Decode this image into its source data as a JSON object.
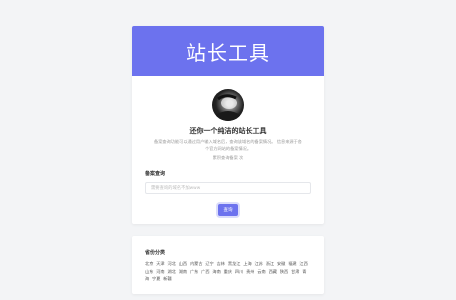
{
  "banner": {
    "title": "站长工具"
  },
  "intro": {
    "subtitle": "还你一个纯洁的站长工具",
    "description": "备案查询功能可以通过用户输入域名后，查询该域名的备案情况。 信息来源于各个官方网站的备案情况。",
    "count_text": "累积查询备案 次"
  },
  "query": {
    "label": "备案查询",
    "placeholder": "需要查询的域名不加www",
    "value": "",
    "button_label": "查询"
  },
  "provinces": {
    "title": "省份分类",
    "items": [
      "北京",
      "天津",
      "河北",
      "山西",
      "内蒙古",
      "辽宁",
      "吉林",
      "黑龙江",
      "上海",
      "江苏",
      "浙江",
      "安徽",
      "福建",
      "江西",
      "山东",
      "河南",
      "湖北",
      "湖南",
      "广东",
      "广西",
      "海南",
      "重庆",
      "四川",
      "贵州",
      "云南",
      "西藏",
      "陕西",
      "甘肃",
      "青海",
      "宁夏",
      "新疆"
    ]
  },
  "colors": {
    "accent": "#6c72ee",
    "background": "#f3f4f6"
  }
}
